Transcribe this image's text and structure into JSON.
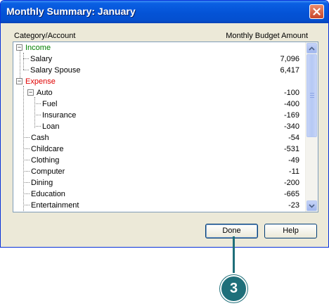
{
  "window": {
    "title": "Monthly Summary: January"
  },
  "list": {
    "col_left": "Category/Account",
    "col_right": "Monthly Budget Amount",
    "rows": [
      {
        "label": "Income",
        "amount": "",
        "kind": "income"
      },
      {
        "label": "Salary",
        "amount": "7,096",
        "kind": "item"
      },
      {
        "label": "Salary Spouse",
        "amount": "6,417",
        "kind": "item"
      },
      {
        "label": "Expense",
        "amount": "",
        "kind": "expense"
      },
      {
        "label": "Auto",
        "amount": "-100",
        "kind": "item"
      },
      {
        "label": "Fuel",
        "amount": "-400",
        "kind": "item"
      },
      {
        "label": "Insurance",
        "amount": "-169",
        "kind": "item"
      },
      {
        "label": "Loan",
        "amount": "-340",
        "kind": "item"
      },
      {
        "label": "Cash",
        "amount": "-54",
        "kind": "item"
      },
      {
        "label": "Childcare",
        "amount": "-531",
        "kind": "item"
      },
      {
        "label": "Clothing",
        "amount": "-49",
        "kind": "item"
      },
      {
        "label": "Computer",
        "amount": "-11",
        "kind": "item"
      },
      {
        "label": "Dining",
        "amount": "-200",
        "kind": "item"
      },
      {
        "label": "Education",
        "amount": "-665",
        "kind": "item"
      },
      {
        "label": "Entertainment",
        "amount": "-23",
        "kind": "item"
      }
    ]
  },
  "buttons": {
    "done": "Done",
    "help": "Help"
  },
  "callout": {
    "number": "3"
  },
  "colors": {
    "income": "#008000",
    "expense": "#e00000",
    "callout": "#1f6f7a"
  }
}
